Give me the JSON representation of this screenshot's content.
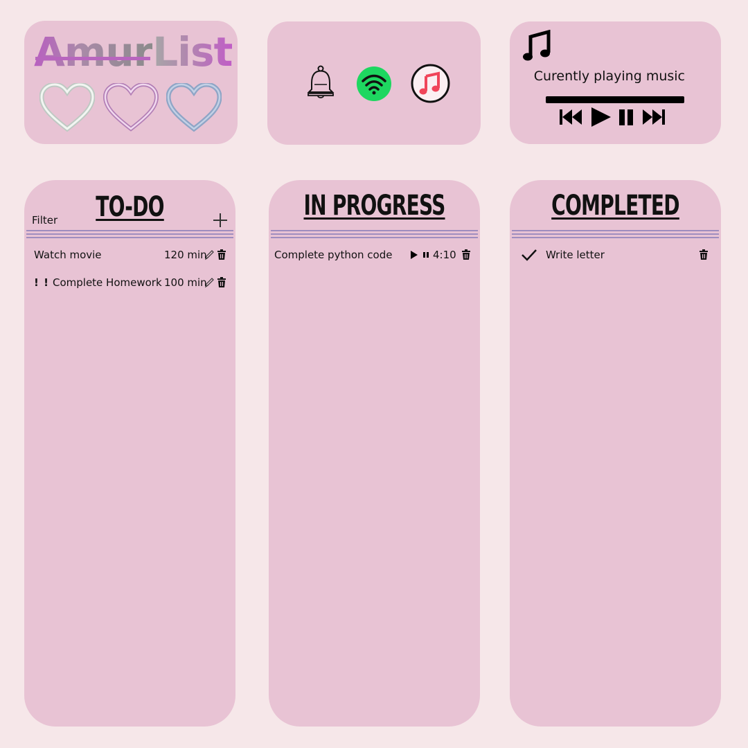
{
  "logo": {
    "text_strike": "Amur",
    "text_plain": "List"
  },
  "hearts": [
    {
      "name": "heart-white-icon",
      "color": "#d8e4dc"
    },
    {
      "name": "heart-pink-icon",
      "color": "#d7a4d8"
    },
    {
      "name": "heart-blue-icon",
      "color": "#9bb0cf"
    }
  ],
  "apps": [
    {
      "icon": "bell-icon"
    },
    {
      "icon": "spotify-icon",
      "color": "#1ed760"
    },
    {
      "icon": "apple-music-icon",
      "color": "#f0455a"
    }
  ],
  "player": {
    "icon": "music-note-icon",
    "status": "Curently playing music",
    "controls": [
      "previous-icon",
      "play-icon",
      "pause-icon",
      "next-icon"
    ]
  },
  "columns": {
    "todo": {
      "title": "TO-DO",
      "filter": "Filter",
      "items": [
        {
          "priority": "",
          "name": "Watch movie",
          "duration": "120 min"
        },
        {
          "priority": "! !",
          "name": "Complete Homework",
          "duration": "100 min"
        }
      ]
    },
    "progress": {
      "title": "IN PROGRESS",
      "items": [
        {
          "name": "Complete python code",
          "time": "4:10"
        }
      ]
    },
    "completed": {
      "title": "COMPLETED",
      "items": [
        {
          "name": "Write letter"
        }
      ]
    }
  },
  "colors": {
    "background": "#f6e7e9",
    "card": "#e8c3d4",
    "divider": "#9f8dbf",
    "logo_accent": "#b865be"
  }
}
